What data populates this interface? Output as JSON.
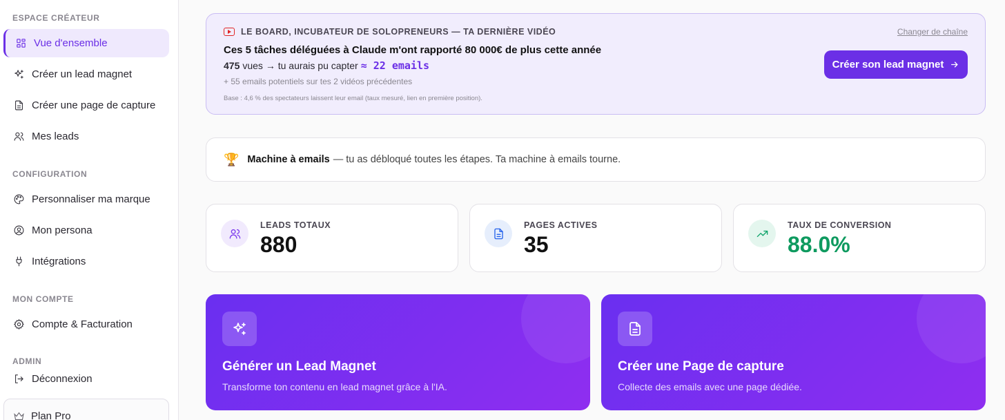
{
  "sidebar": {
    "sections": {
      "creator": "ESPACE CRÉATEUR",
      "config": "CONFIGURATION",
      "account": "MON COMPTE",
      "admin": "ADMIN"
    },
    "items": [
      {
        "label": "Vue d'ensemble",
        "icon": "grid-icon",
        "active": true
      },
      {
        "label": "Créer un lead magnet",
        "icon": "sparkles-icon"
      },
      {
        "label": "Créer une page de capture",
        "icon": "document-icon"
      },
      {
        "label": "Mes leads",
        "icon": "users-icon"
      },
      {
        "label": "Personnaliser ma marque",
        "icon": "palette-icon"
      },
      {
        "label": "Mon persona",
        "icon": "user-circle-icon"
      },
      {
        "label": "Intégrations",
        "icon": "plug-icon"
      },
      {
        "label": "Compte & Facturation",
        "icon": "gear-icon"
      },
      {
        "label": "Déconnexion",
        "icon": "logout-icon"
      }
    ],
    "plan": "Plan Pro"
  },
  "banner": {
    "tag": "LE BOARD, INCUBATEUR DE SOLOPRENEURS — TA DERNIÈRE VIDÉO",
    "change_link": "Changer de chaîne",
    "video_title": "Ces 5 tâches déléguées à Claude m'ont rapporté 80 000€ de plus cette année",
    "views": "475",
    "views_text": "vues → tu aurais pu capter",
    "emails": "≈ 22 emails",
    "potential": "+ 55 emails potentiels sur tes 2 vidéos précédentes",
    "base_note": "Base : 4,6 % des spectateurs laissent leur email (taux mesuré, lien en première position).",
    "cta": "Créer son lead magnet"
  },
  "machine": {
    "title": "Machine à emails",
    "text": "— tu as débloqué toutes les étapes. Ta machine à emails tourne."
  },
  "stats": [
    {
      "label": "LEADS TOTAUX",
      "value": "880",
      "icon": "users-icon",
      "color": "#7c3aed",
      "bg": "#f1eafd",
      "value_color": "#111111"
    },
    {
      "label": "PAGES ACTIVES",
      "value": "35",
      "icon": "document-icon",
      "color": "#2563eb",
      "bg": "#e6eefc",
      "value_color": "#111111"
    },
    {
      "label": "TAUX DE CONVERSION",
      "value": "88.0%",
      "icon": "trending-up-icon",
      "color": "#10a36a",
      "bg": "#e4f6ee",
      "value_color": "#0e9a5f"
    }
  ],
  "actions": [
    {
      "title": "Générer un Lead Magnet",
      "desc": "Transforme ton contenu en lead magnet grâce à l'IA.",
      "icon": "sparkles-icon"
    },
    {
      "title": "Créer une Page de capture",
      "desc": "Collecte des emails avec une page dédiée.",
      "icon": "document-icon"
    }
  ],
  "colors": {
    "accent": "#6b2fe6",
    "youtube": "#e02424"
  }
}
